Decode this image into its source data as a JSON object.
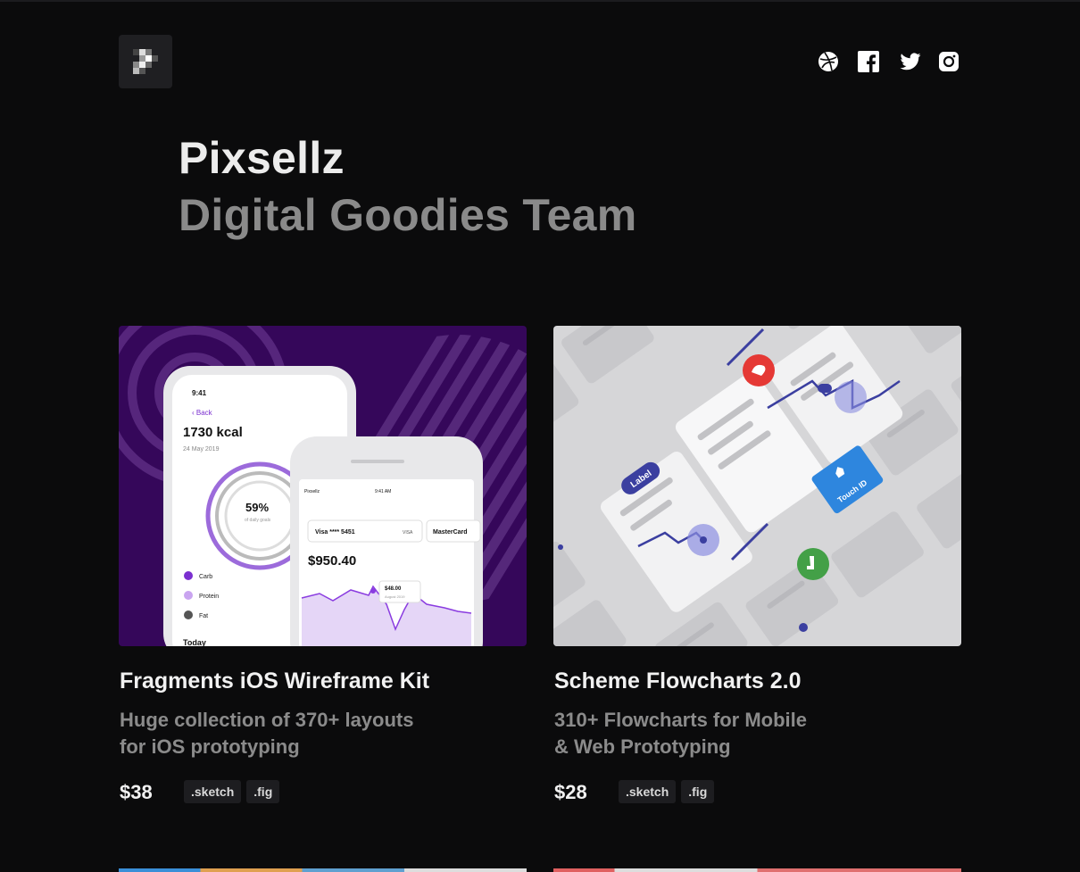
{
  "brand": {
    "logo_icon": "pixellz-logo-icon"
  },
  "social": [
    {
      "name": "dribbble-icon"
    },
    {
      "name": "facebook-icon"
    },
    {
      "name": "twitter-icon"
    },
    {
      "name": "instagram-icon"
    }
  ],
  "hero": {
    "title": "Pixsellz",
    "subtitle": "Digital Goodies Team"
  },
  "products": [
    {
      "title": "Fragments iOS Wireframe Kit",
      "desc_line1": "Huge collection of 370+ layouts",
      "desc_line2": "for iOS prototyping",
      "price": "$38",
      "tags": [
        ".sketch",
        ".fig"
      ],
      "thumb": {
        "time1": "9:41",
        "back": "Back",
        "kcal": "1730 kcal",
        "date": "24 May 2019",
        "percent": "59%",
        "percent_caption": "of daily goals",
        "legend": [
          "Carb",
          "Protein",
          "Fat"
        ],
        "today": "Today",
        "carrier": "Pixsellz",
        "time2": "9:41 AM",
        "card_number": "Visa **** 5451",
        "card_brand": "VISA",
        "card_next": "MasterCard",
        "balance": "$950.40",
        "tooltip_amount": "$48.00",
        "tooltip_date": "August 2019"
      }
    },
    {
      "title": "Scheme Flowcharts 2.0",
      "desc_line1": "310+ Flowcharts for Mobile",
      "desc_line2": "& Web Prototyping",
      "price": "$28",
      "tags": [
        ".sketch",
        ".fig"
      ],
      "thumb": {
        "label_chip": "Label",
        "touch_chip": "Touch ID"
      }
    }
  ],
  "colors": {
    "background": "#0b0b0c",
    "purple": "#3a0a5c",
    "accent_purple": "#8a3ce0",
    "flow_blue": "#2e86de",
    "flow_red": "#e53935",
    "flow_green": "#43a047"
  }
}
